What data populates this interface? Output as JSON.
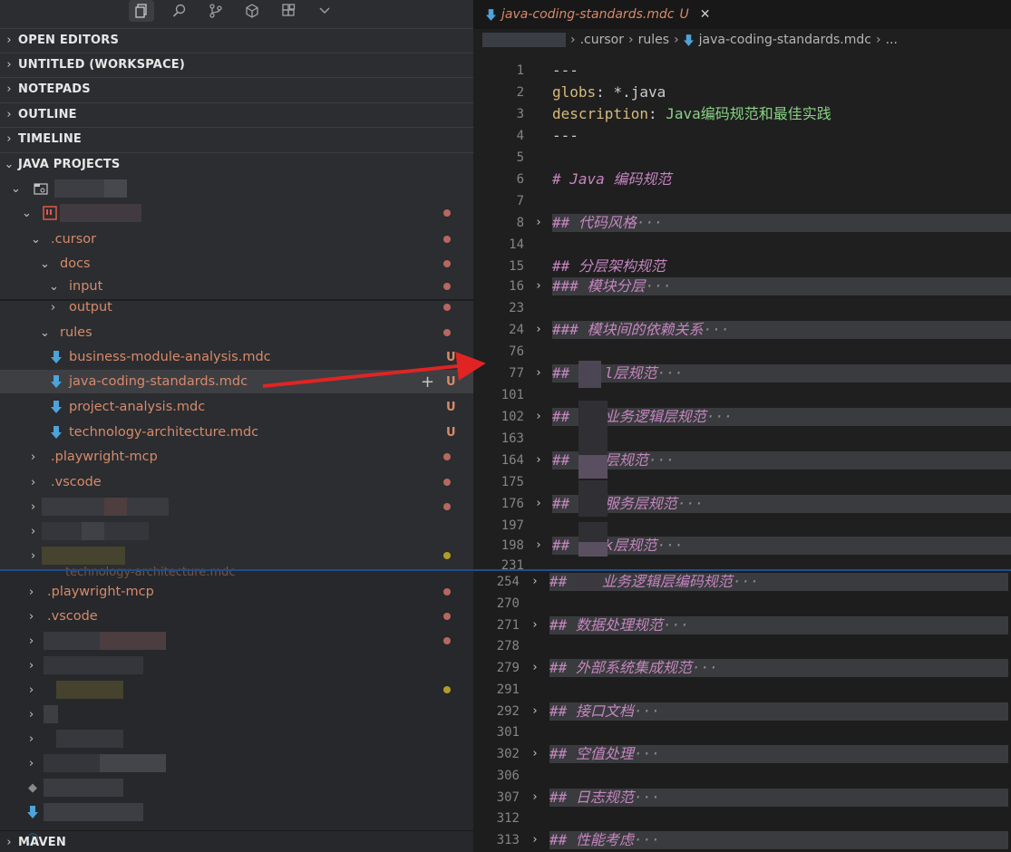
{
  "sidebar": {
    "sections": [
      {
        "label": "OPEN EDITORS"
      },
      {
        "label": "UNTITLED (WORKSPACE)"
      },
      {
        "label": "NOTEPADS"
      },
      {
        "label": "OUTLINE"
      },
      {
        "label": "TIMELINE"
      },
      {
        "label": "JAVA PROJECTS"
      },
      {
        "label": "MAVEN"
      }
    ],
    "tree": {
      "cursor": ".cursor",
      "docs": "docs",
      "input": "input",
      "output": "output",
      "rules": "rules",
      "file1": "business-module-analysis.mdc",
      "file2": "java-coding-standards.mdc",
      "file3": "project-analysis.mdc",
      "file4": "technology-architecture.mdc",
      "playwright": ".playwright-mcp",
      "vscode": ".vscode",
      "playwright2": ".playwright-mcp",
      "vscode2": ".vscode",
      "overlap_text": "technology-architecture.mdc",
      "untracked_badge": "U"
    }
  },
  "editor": {
    "tab": {
      "label": "java-coding-standards.mdc",
      "badge": "U"
    },
    "breadcrumbs": [
      ".cursor",
      "rules",
      "java-coding-standards.mdc",
      "..."
    ]
  },
  "colors": {
    "accent_orange": "#d88a6a",
    "heading_purple": "#c586c0",
    "yaml_key": "#d7ba7d",
    "yaml_value": "#89d185",
    "arrow_red": "#e02424"
  },
  "icons": [
    "files-icon",
    "search-icon",
    "source-control-icon",
    "extensions-icon",
    "chevron-down-icon",
    "arrow-down-icon",
    "close-icon",
    "info-icon"
  ]
}
